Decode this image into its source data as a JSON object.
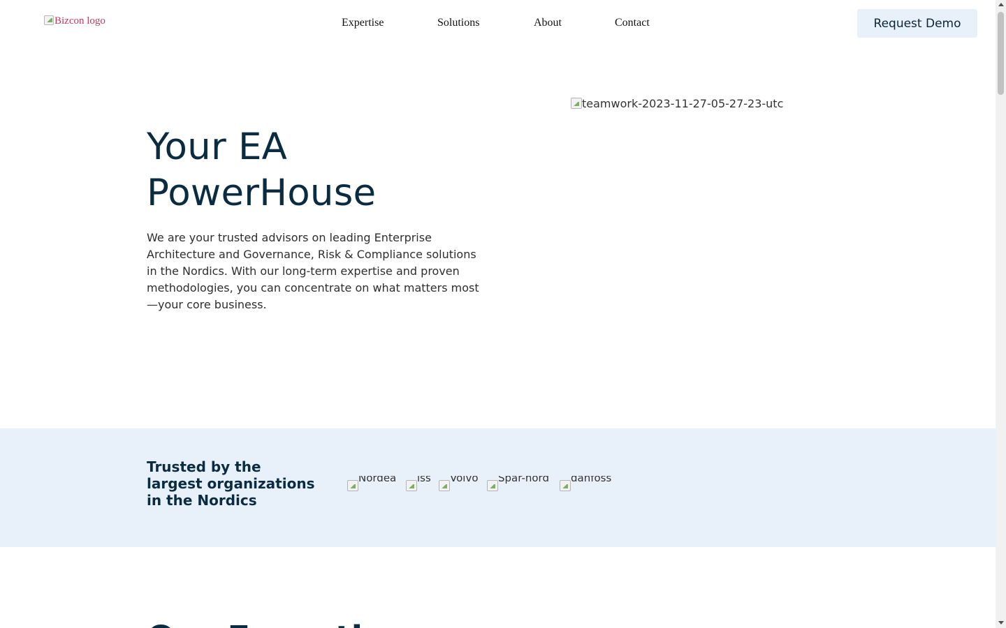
{
  "header": {
    "logo_alt": "Bizcon logo",
    "nav": [
      "Expertise",
      "Solutions",
      "About",
      "Contact"
    ],
    "cta_label": "Request Demo"
  },
  "hero": {
    "title_line1": "Your EA",
    "title_line2": "PowerHouse",
    "description": "We are your trusted advisors on leading Enterprise Architecture and Governance, Risk & Compliance solutions in the Nordics. With our long-term expertise and proven methodologies, you can concentrate on what matters most—your core business.",
    "image_alt": "teamwork-2023-11-27-05-27-23-utc"
  },
  "trusted": {
    "heading_pre": "Trusted by the ",
    "heading_bold": "largest",
    "heading_post": " organizations in the Nordics",
    "clients": [
      "Nordea",
      "iss",
      "Volvo",
      "Spar-nord",
      "danfoss"
    ]
  },
  "next_section": {
    "heading_partial": "Our Expertise"
  },
  "colors": {
    "brand_dark": "#0b2c40",
    "accent_band": "#e8f0fa",
    "logo_alt_text": "#c0395e"
  }
}
